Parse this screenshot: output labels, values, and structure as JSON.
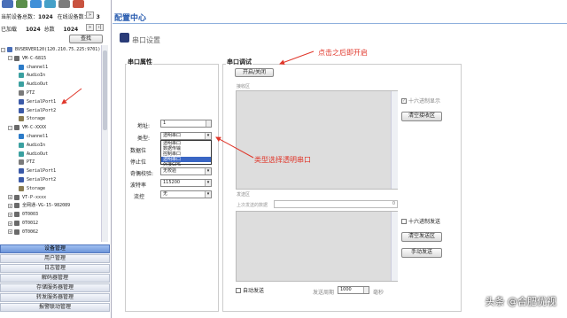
{
  "toolbar": {
    "icons": [
      "user-icon",
      "chart-icon",
      "map-icon",
      "globe-icon",
      "gear-icon",
      "exit-icon"
    ]
  },
  "stats": {
    "total_label": "当前设备总数：",
    "total_value": "1024",
    "online_label": "在线设备数：",
    "online_value": "3",
    "loaded_label": "已加载",
    "loaded_value": "1024",
    "all_label": "总数",
    "all_value": "1024",
    "prev_icon": "double-right-arrow",
    "next_icon": "double-bar-right-arrow"
  },
  "query_label": "查找",
  "tree": [
    {
      "label": "BVSERVER120(120.210.75.225:9701)",
      "icon": "server-icon",
      "exp": "-"
    },
    {
      "label": "VM-C-6815",
      "icon": "device-icon",
      "exp": "-"
    },
    {
      "label": "channel1",
      "icon": "camera-icon"
    },
    {
      "label": "AudioIn",
      "icon": "audio-icon"
    },
    {
      "label": "AudioOut",
      "icon": "audio-icon"
    },
    {
      "label": "PTZ",
      "icon": "ptz-icon"
    },
    {
      "label": "SerialPort1",
      "icon": "serial-icon"
    },
    {
      "label": "SerialPort2",
      "icon": "serial-icon"
    },
    {
      "label": "Storage",
      "icon": "storage-icon"
    },
    {
      "label": "VM-C-XXXX",
      "icon": "device-icon",
      "exp": "-"
    },
    {
      "label": "channel1",
      "icon": "camera-icon"
    },
    {
      "label": "AudioIn",
      "icon": "audio-icon"
    },
    {
      "label": "AudioOut",
      "icon": "audio-icon"
    },
    {
      "label": "PTZ",
      "icon": "ptz-icon"
    },
    {
      "label": "SerialPort1",
      "icon": "serial-icon"
    },
    {
      "label": "SerialPort2",
      "icon": "serial-icon"
    },
    {
      "label": "Storage",
      "icon": "storage-icon"
    },
    {
      "label": "VT-P-xxxx",
      "icon": "device-icon",
      "exp": "+"
    },
    {
      "label": "全网通-VG-15-982089",
      "icon": "device-icon",
      "exp": "+"
    },
    {
      "label": "0T0003",
      "icon": "device-icon",
      "exp": "+"
    },
    {
      "label": "0T0012",
      "icon": "device-icon",
      "exp": "+"
    },
    {
      "label": "0T0062",
      "icon": "device-icon",
      "exp": "+"
    }
  ],
  "menu": [
    {
      "label": "设备管理",
      "active": true
    },
    {
      "label": "用户管理"
    },
    {
      "label": "日志管理"
    },
    {
      "label": "解码器管理"
    },
    {
      "label": "存储服务器管理"
    },
    {
      "label": "转发服务器管理"
    },
    {
      "label": "报警联动管理"
    }
  ],
  "main": {
    "title": "配置中心",
    "section_title": "串口设置",
    "section_icon": "serial-config-icon"
  },
  "props": {
    "title": "串口属性",
    "address_label": "地址:",
    "address_value": "1",
    "type_label": "类型:",
    "type_value": "透明串口",
    "databits_label": "数据位",
    "stopbits_label": "停止位",
    "parity_label": "奇偶校验:",
    "parity_value": "无校验",
    "baud_label": "波特率",
    "baud_value": "115200",
    "flow_label": "流控",
    "flow_value": "无"
  },
  "dropdown_options": [
    "透明串口",
    "数据传输",
    "控制串口",
    "透明串口",
    "外接GPS"
  ],
  "dropdown_highlight": 3,
  "debug": {
    "title": "串口调试",
    "toggle_label": "开启/关闭",
    "recv_area_label": "接收区",
    "hex_display_label": "十六进制显示",
    "clear_recv_label": "清空接收区",
    "send_area_label": "发送区",
    "last_sent_label": "上次发送的数据",
    "last_sent_value": "0",
    "hex_send_label": "十六进制发送",
    "clear_send_label": "清空发送区",
    "manual_send_label": "手动发送",
    "auto_send_label": "自动发送",
    "period_label": "发送周期",
    "period_value": "1000",
    "ms_label": "毫秒"
  },
  "annotations": {
    "top": "点击之后即开启",
    "middle": "类型选择透明串口"
  },
  "colors": {
    "accent": "#2a5db0",
    "annotation": "#e0362a",
    "menu_active": "#6d95d9"
  },
  "watermark": "头条 @合肥优视"
}
